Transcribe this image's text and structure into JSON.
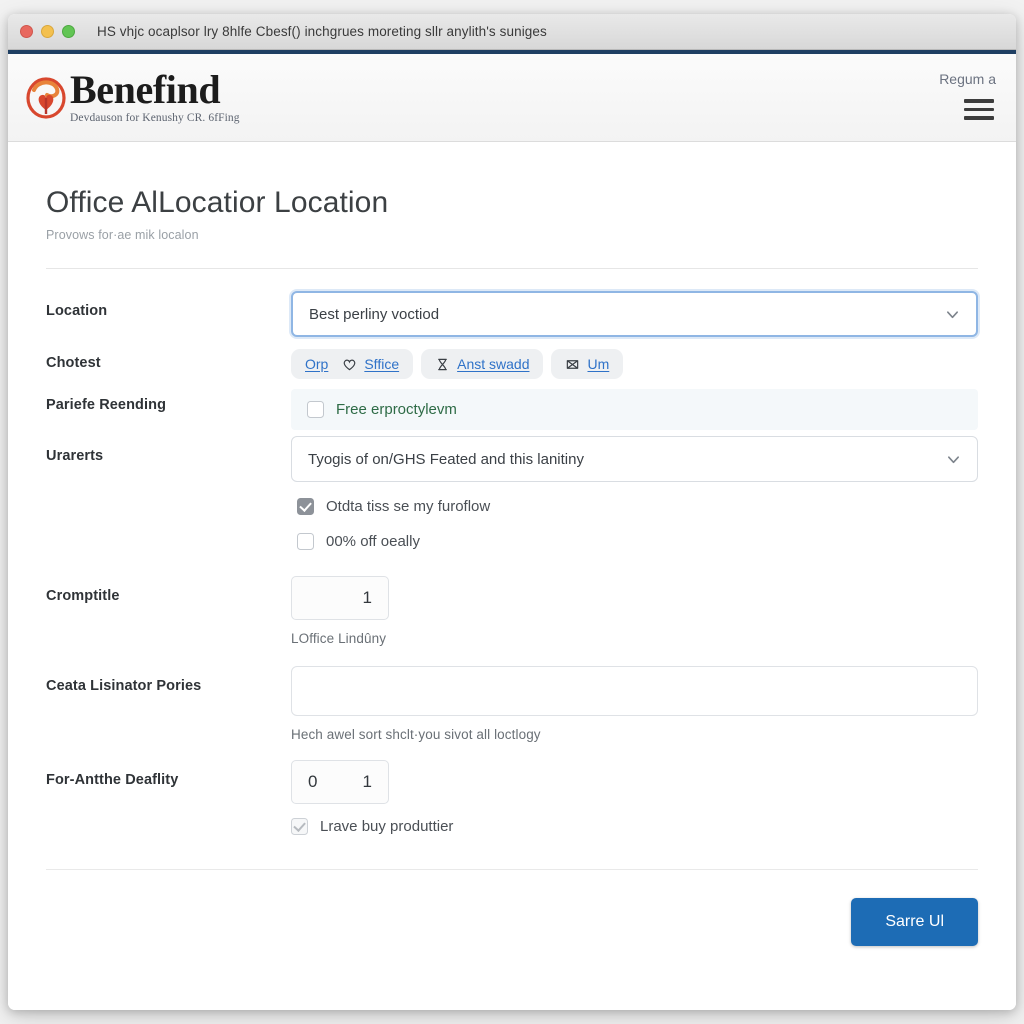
{
  "window": {
    "title": "HS vhjc ocaplsor lry 8hlfe Cbesf() inchgrues moreting sllr anylith's suniges",
    "traffic_lights": [
      "close",
      "minimize",
      "zoom"
    ]
  },
  "header": {
    "brand_name": "Benefind",
    "brand_tagline": "Devdauson for Kenushy CR. 6fFing",
    "right_link": "Regum a",
    "menu_icon": "hamburger-icon"
  },
  "page": {
    "title": "Office AlLocatior Location",
    "subtitle": "Provows for·ae mik localon"
  },
  "form": {
    "location": {
      "label": "Location",
      "value": "Best perliny voctiod",
      "chevron": "chevron-down-icon"
    },
    "chotest": {
      "label": "Chotest",
      "chips": [
        {
          "label": "Orp",
          "icon": null
        },
        {
          "label": "Sffice",
          "icon": "heart-icon"
        },
        {
          "label": "Anst swadd",
          "icon": "hourglass-icon"
        },
        {
          "label": "Um",
          "icon": "envelope-icon"
        }
      ]
    },
    "pariefe": {
      "label": "Pariefe Reending",
      "checkbox_checked": false,
      "checkbox_label": "Free erproctylevm"
    },
    "urarerts": {
      "label": "Urarerts",
      "value": "Tyogis of on/GHS Feated and this lanitiny",
      "chevron": "chevron-down-icon",
      "options": [
        {
          "label": "Otdta tiss se my furoflow",
          "checked": true
        },
        {
          "label": "00% off oeally",
          "checked": false
        }
      ]
    },
    "cromptitle": {
      "label": "Cromptitle",
      "value": "1",
      "helper": "LOffice Lindûny"
    },
    "ceata": {
      "label": "Ceata Lisinator Pories",
      "value": "",
      "placeholder": "",
      "helper": "Hech awel sort shclt·you sivot all loctlogy"
    },
    "forantthe": {
      "label": "For-Antthe Deaflity",
      "value_left": "0",
      "value_right": "1",
      "checkbox_checked": true,
      "checkbox_label": "Lrave buy produttier"
    }
  },
  "footer": {
    "save_label": "Sarre Ul"
  },
  "colors": {
    "accent_bar": "#1f3f63",
    "primary_button": "#1d6cb5",
    "link": "#2f72c8",
    "green_text": "#2e6b46",
    "focus_border": "#8fb6e4"
  }
}
